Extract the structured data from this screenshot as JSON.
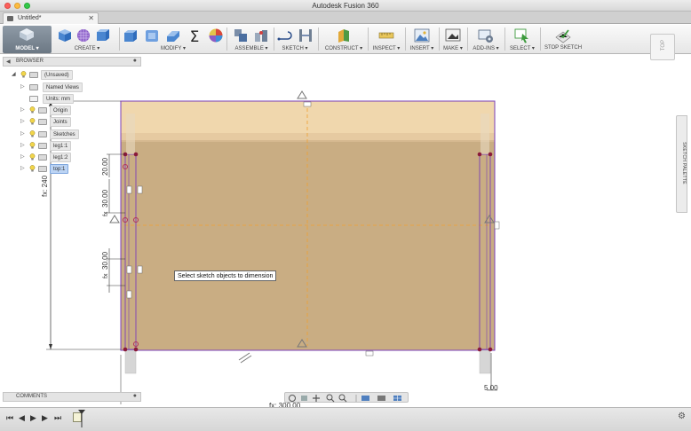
{
  "window": {
    "app_title": "Autodesk Fusion 360"
  },
  "tab": {
    "label": "Untitled*",
    "close": "✕"
  },
  "ribbon": {
    "workspace": "MODEL ▾",
    "groups": [
      {
        "label": "CREATE ▾"
      },
      {
        "label": "MODIFY ▾"
      },
      {
        "label": "ASSEMBLE ▾"
      },
      {
        "label": "SKETCH ▾"
      },
      {
        "label": "CONSTRUCT ▾"
      },
      {
        "label": "INSPECT ▾"
      },
      {
        "label": "INSERT ▾"
      },
      {
        "label": "MAKE ▾"
      },
      {
        "label": "ADD-INS ▾"
      },
      {
        "label": "SELECT ▾"
      },
      {
        "label": "STOP SKETCH"
      }
    ],
    "view_cube": "TOP"
  },
  "browser": {
    "title": "BROWSER",
    "items": [
      {
        "label": "(Unsaved)"
      },
      {
        "label": "Named Views"
      },
      {
        "label": "Units: mm"
      },
      {
        "label": "Origin"
      },
      {
        "label": "Joints"
      },
      {
        "label": "Sketches"
      },
      {
        "label": "leg1:1"
      },
      {
        "label": "leg1:2"
      },
      {
        "label": "top:1"
      }
    ]
  },
  "comments": {
    "title": "COMMENTS"
  },
  "palette": {
    "title": "SKETCH PALETTE"
  },
  "canvas": {
    "tooltip": "Select sketch objects to dimension",
    "dims": {
      "d20": "20.00",
      "d30a": "30.00",
      "d30b": "30.00",
      "d240": "fx: 240",
      "d5": "5.00",
      "dbottom": "fx: 300.00"
    }
  },
  "colors": {
    "panel_fill": "#c9ad83",
    "panel_top": "#f0d7ad",
    "sketch_line": "#7a3fb8",
    "constraint_point": "#8a1a3a",
    "center_line": "#f0a030"
  }
}
